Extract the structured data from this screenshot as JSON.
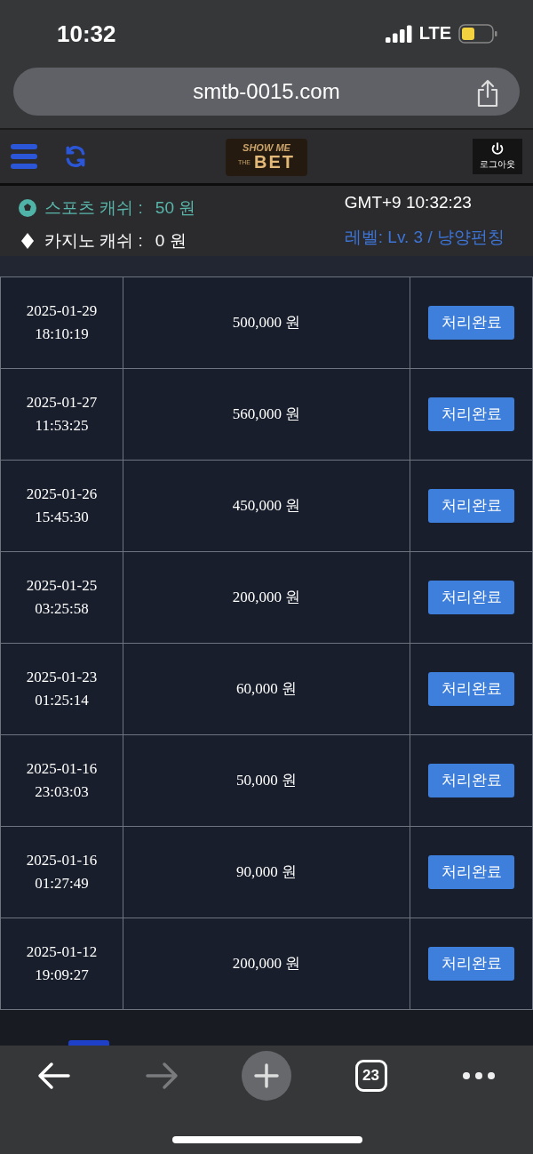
{
  "status_bar": {
    "time": "10:32",
    "network": "LTE"
  },
  "address_bar": {
    "url": "smtb-0015.com"
  },
  "header": {
    "logo": {
      "top": "SHOW",
      "side": "ME",
      "small": "THE",
      "main": "BET"
    },
    "logout_label": "로그아웃"
  },
  "account": {
    "sports_label": "스포츠 캐쉬 :",
    "sports_value": "50 원",
    "casino_label": "카지노 캐쉬 :",
    "casino_value": "0 원",
    "clock": "GMT+9 10:32:23",
    "level": "레벨: Lv. 3 / 냥양펀칭"
  },
  "rows": [
    {
      "date": "2025-01-29",
      "time": "18:10:19",
      "amount": "500,000 원",
      "status": "처리완료"
    },
    {
      "date": "2025-01-27",
      "time": "11:53:25",
      "amount": "560,000 원",
      "status": "처리완료"
    },
    {
      "date": "2025-01-26",
      "time": "15:45:30",
      "amount": "450,000 원",
      "status": "처리완료"
    },
    {
      "date": "2025-01-25",
      "time": "03:25:58",
      "amount": "200,000 원",
      "status": "처리완료"
    },
    {
      "date": "2025-01-23",
      "time": "01:25:14",
      "amount": "60,000 원",
      "status": "처리완료"
    },
    {
      "date": "2025-01-16",
      "time": "23:03:03",
      "amount": "50,000 원",
      "status": "처리완료"
    },
    {
      "date": "2025-01-16",
      "time": "01:27:49",
      "amount": "90,000 원",
      "status": "처리완료"
    },
    {
      "date": "2025-01-12",
      "time": "19:09:27",
      "amount": "200,000 원",
      "status": "처리완료"
    }
  ],
  "toolbar": {
    "tab_count": "23"
  }
}
